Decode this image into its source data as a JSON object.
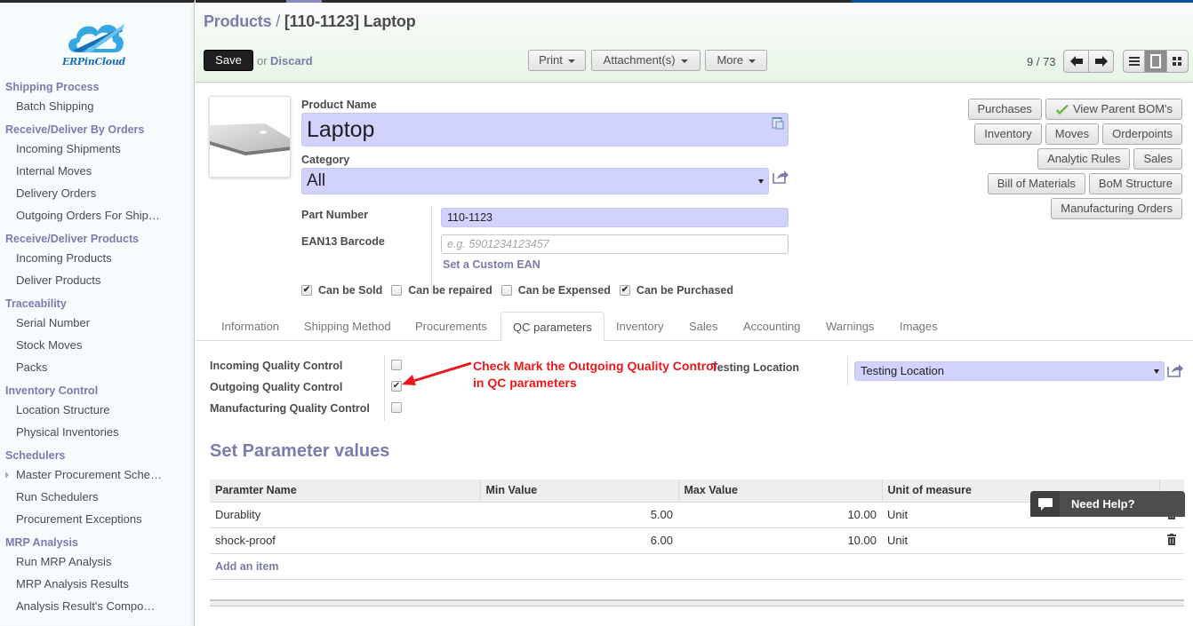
{
  "brand": {
    "name": "ERPinCloud",
    "accent": "#7c7bad",
    "header_gradient_end": "#e6f6e6"
  },
  "sidebar": {
    "sections": [
      {
        "heading": "Shipping Process",
        "items": [
          {
            "label": "Batch Shipping"
          }
        ]
      },
      {
        "heading": "Receive/Deliver By Orders",
        "items": [
          {
            "label": "Incoming Shipments"
          },
          {
            "label": "Internal Moves"
          },
          {
            "label": "Delivery Orders"
          },
          {
            "label": "Outgoing Orders For Ship…"
          }
        ]
      },
      {
        "heading": "Receive/Deliver Products",
        "items": [
          {
            "label": "Incoming Products"
          },
          {
            "label": "Deliver Products"
          }
        ]
      },
      {
        "heading": "Traceability",
        "items": [
          {
            "label": "Serial Number"
          },
          {
            "label": "Stock Moves"
          },
          {
            "label": "Packs"
          }
        ]
      },
      {
        "heading": "Inventory Control",
        "items": [
          {
            "label": "Location Structure"
          },
          {
            "label": "Physical Inventories"
          }
        ]
      },
      {
        "heading": "Schedulers",
        "items": [
          {
            "label": "Master Procurement Sche…",
            "expandable": true
          },
          {
            "label": "Run Schedulers"
          },
          {
            "label": "Procurement Exceptions"
          }
        ]
      },
      {
        "heading": "MRP Analysis",
        "items": [
          {
            "label": "Run MRP Analysis"
          },
          {
            "label": "MRP Analysis Results"
          },
          {
            "label": "Analysis Result's Compo…"
          }
        ]
      }
    ]
  },
  "header": {
    "breadcrumb_parent": "Products",
    "breadcrumb_sep": "/",
    "breadcrumb_current": "[110-1123] Laptop",
    "save_label": "Save",
    "or_label": "or",
    "discard_label": "Discard",
    "toolbar": {
      "print": "Print",
      "attachments": "Attachment(s)",
      "more": "More"
    },
    "pager": {
      "value": "9 / 73"
    },
    "view_modes": [
      "list",
      "form",
      "kanban"
    ],
    "active_view": "form"
  },
  "form": {
    "product_name_label": "Product Name",
    "product_name": "Laptop",
    "category_label": "Category",
    "category": "All",
    "part_number_label": "Part Number",
    "part_number": "110-1123",
    "ean_label": "EAN13 Barcode",
    "ean_placeholder": "e.g. 5901234123457",
    "ean_link": "Set a Custom EAN",
    "flags": [
      {
        "label": "Can be Sold",
        "checked": true
      },
      {
        "label": "Can be repaired",
        "checked": false
      },
      {
        "label": "Can be Expensed",
        "checked": false
      },
      {
        "label": "Can be Purchased",
        "checked": true
      }
    ]
  },
  "smart_buttons": {
    "rows": [
      [
        "Purchases",
        "View Parent BOM's"
      ],
      [
        "Inventory",
        "Moves",
        "Orderpoints"
      ],
      [
        "Analytic Rules",
        "Sales"
      ],
      [
        "Bill of Materials",
        "BoM Structure"
      ],
      [
        "Manufacturing Orders"
      ]
    ]
  },
  "tabs": {
    "items": [
      "Information",
      "Shipping Method",
      "Procurements",
      "QC parameters",
      "Inventory",
      "Sales",
      "Accounting",
      "Warnings",
      "Images"
    ],
    "active": "QC parameters"
  },
  "qc": {
    "incoming_label": "Incoming Quality Control",
    "incoming_checked": false,
    "outgoing_label": "Outgoing Quality Control",
    "outgoing_checked": true,
    "manufacturing_label": "Manufacturing Quality Control",
    "manufacturing_checked": false,
    "testing_location_label": "Testing Location",
    "testing_location_value": "Testing Location",
    "annotation_line1": "Check Mark the Outgoing Quality Control",
    "annotation_line2": "in QC parameters",
    "annotation_color": "#e8191d"
  },
  "parameters": {
    "title": "Set Parameter values",
    "columns": [
      "Paramter Name",
      "Min Value",
      "Max Value",
      "Unit of measure"
    ],
    "rows": [
      {
        "name": "Durablity",
        "min": "5.00",
        "max": "10.00",
        "uom": "Unit"
      },
      {
        "name": "shock-proof",
        "min": "6.00",
        "max": "10.00",
        "uom": "Unit"
      }
    ],
    "add_label": "Add an item"
  },
  "help_widget": {
    "label": "Need Help?"
  }
}
